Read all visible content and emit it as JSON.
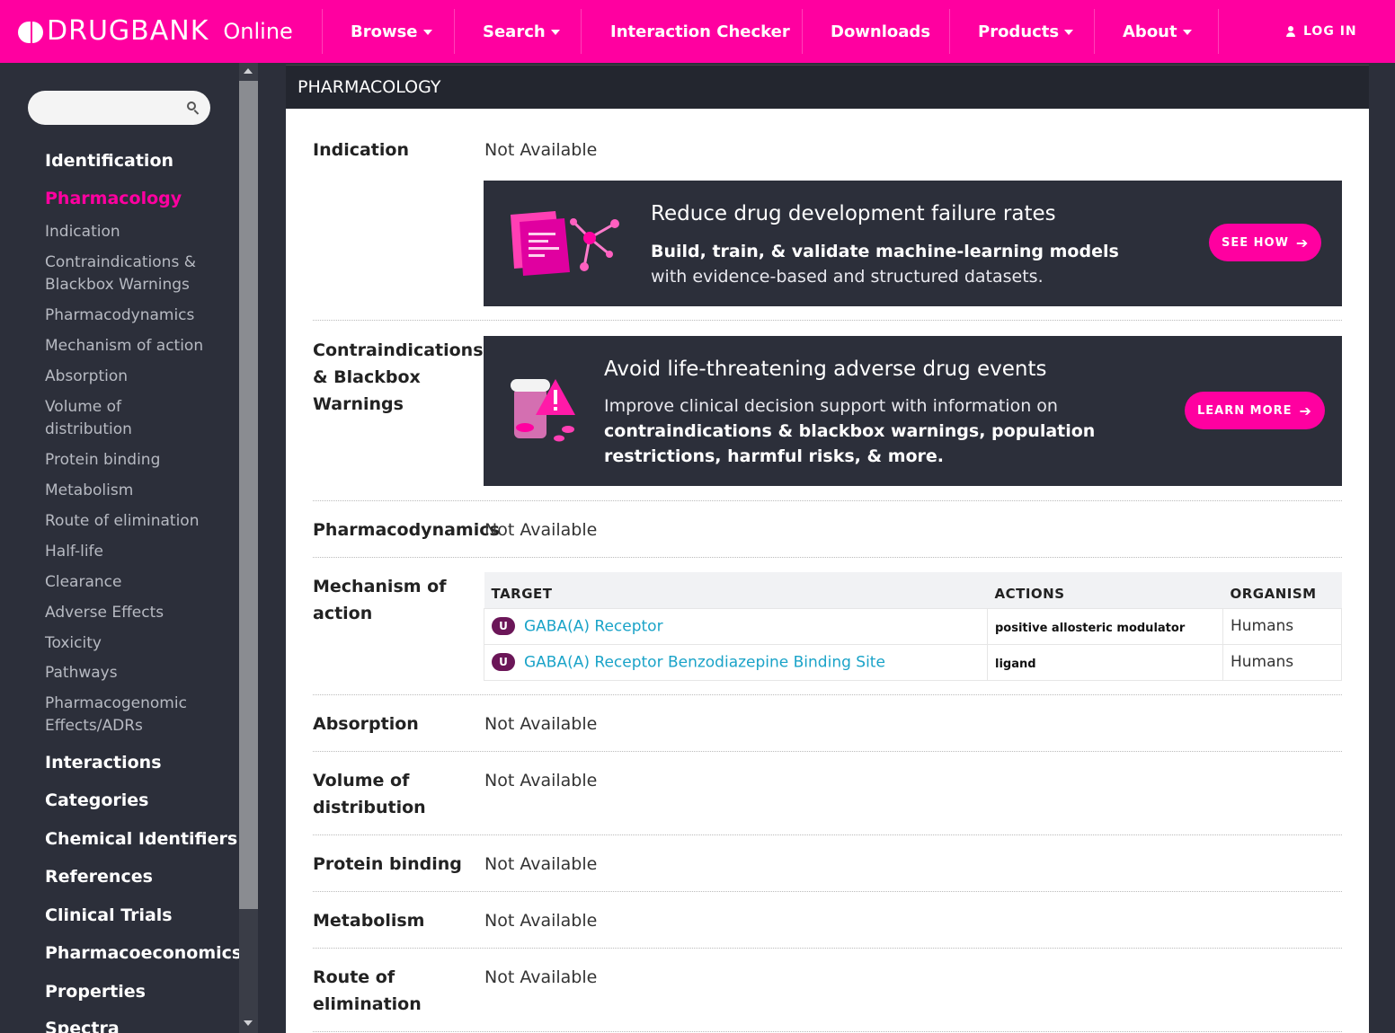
{
  "nav": {
    "brand": "DRUGBANK",
    "brand_suffix": "Online",
    "items": [
      {
        "label": "Browse",
        "dropdown": true
      },
      {
        "label": "Search",
        "dropdown": true
      },
      {
        "label": "Interaction Checker",
        "dropdown": false
      },
      {
        "label": "Downloads",
        "dropdown": false
      },
      {
        "label": "Products",
        "dropdown": true
      },
      {
        "label": "About",
        "dropdown": true
      }
    ],
    "login": "LOG IN",
    "color": "#ff00a0"
  },
  "sidebar": {
    "search_placeholder": "",
    "sections": [
      {
        "label": "Identification"
      },
      {
        "label": "Pharmacology",
        "active": true
      },
      {
        "label": "Interactions"
      },
      {
        "label": "Categories"
      },
      {
        "label": "Chemical Identifiers"
      },
      {
        "label": "References"
      },
      {
        "label": "Clinical Trials"
      },
      {
        "label": "Pharmacoeconomics"
      },
      {
        "label": "Properties"
      },
      {
        "label": "Spectra"
      }
    ],
    "sub_items": [
      "Indication",
      "Contraindications & Blackbox Warnings",
      "Pharmacodynamics",
      "Mechanism of action",
      "Absorption",
      "Volume of distribution",
      "Protein binding",
      "Metabolism",
      "Route of elimination",
      "Half-life",
      "Clearance",
      "Adverse Effects",
      "Toxicity",
      "Pathways",
      "Pharmacogenomic Effects/ADRs"
    ]
  },
  "main": {
    "section_title": "PHARMACOLOGY",
    "fields": {
      "indication": {
        "label": "Indication",
        "value": "Not Available"
      },
      "contraindications": {
        "label": "Contraindications & Blackbox Warnings"
      },
      "pharmacodynamics": {
        "label": "Pharmacodynamics",
        "value": "Not Available"
      },
      "mechanism": {
        "label": "Mechanism of action"
      },
      "absorption": {
        "label": "Absorption",
        "value": "Not Available"
      },
      "volume": {
        "label": "Volume of distribution",
        "value": "Not Available"
      },
      "protein_binding": {
        "label": "Protein binding",
        "value": "Not Available"
      },
      "metabolism": {
        "label": "Metabolism",
        "value": "Not Available"
      },
      "route": {
        "label": "Route of elimination",
        "value": "Not Available"
      }
    },
    "promo1": {
      "title": "Reduce drug development failure rates",
      "text_bold": "Build, train, & validate machine-learning models",
      "text": "with evidence-based and structured datasets.",
      "button": "SEE HOW"
    },
    "promo2": {
      "title": "Avoid life-threatening adverse drug events",
      "text": "Improve clinical decision support with information on",
      "text_bold": "contraindications & blackbox warnings, population restrictions, harmful risks, & more.",
      "button": "LEARN MORE"
    },
    "moa_table": {
      "headers": [
        "TARGET",
        "ACTIONS",
        "ORGANISM"
      ],
      "rows": [
        {
          "badge": "U",
          "target": "GABA(A) Receptor",
          "action": "positive allosteric modulator",
          "organism": "Humans"
        },
        {
          "badge": "U",
          "target": "GABA(A) Receptor Benzodiazepine Binding Site",
          "action": "ligand",
          "organism": "Humans"
        }
      ]
    }
  }
}
